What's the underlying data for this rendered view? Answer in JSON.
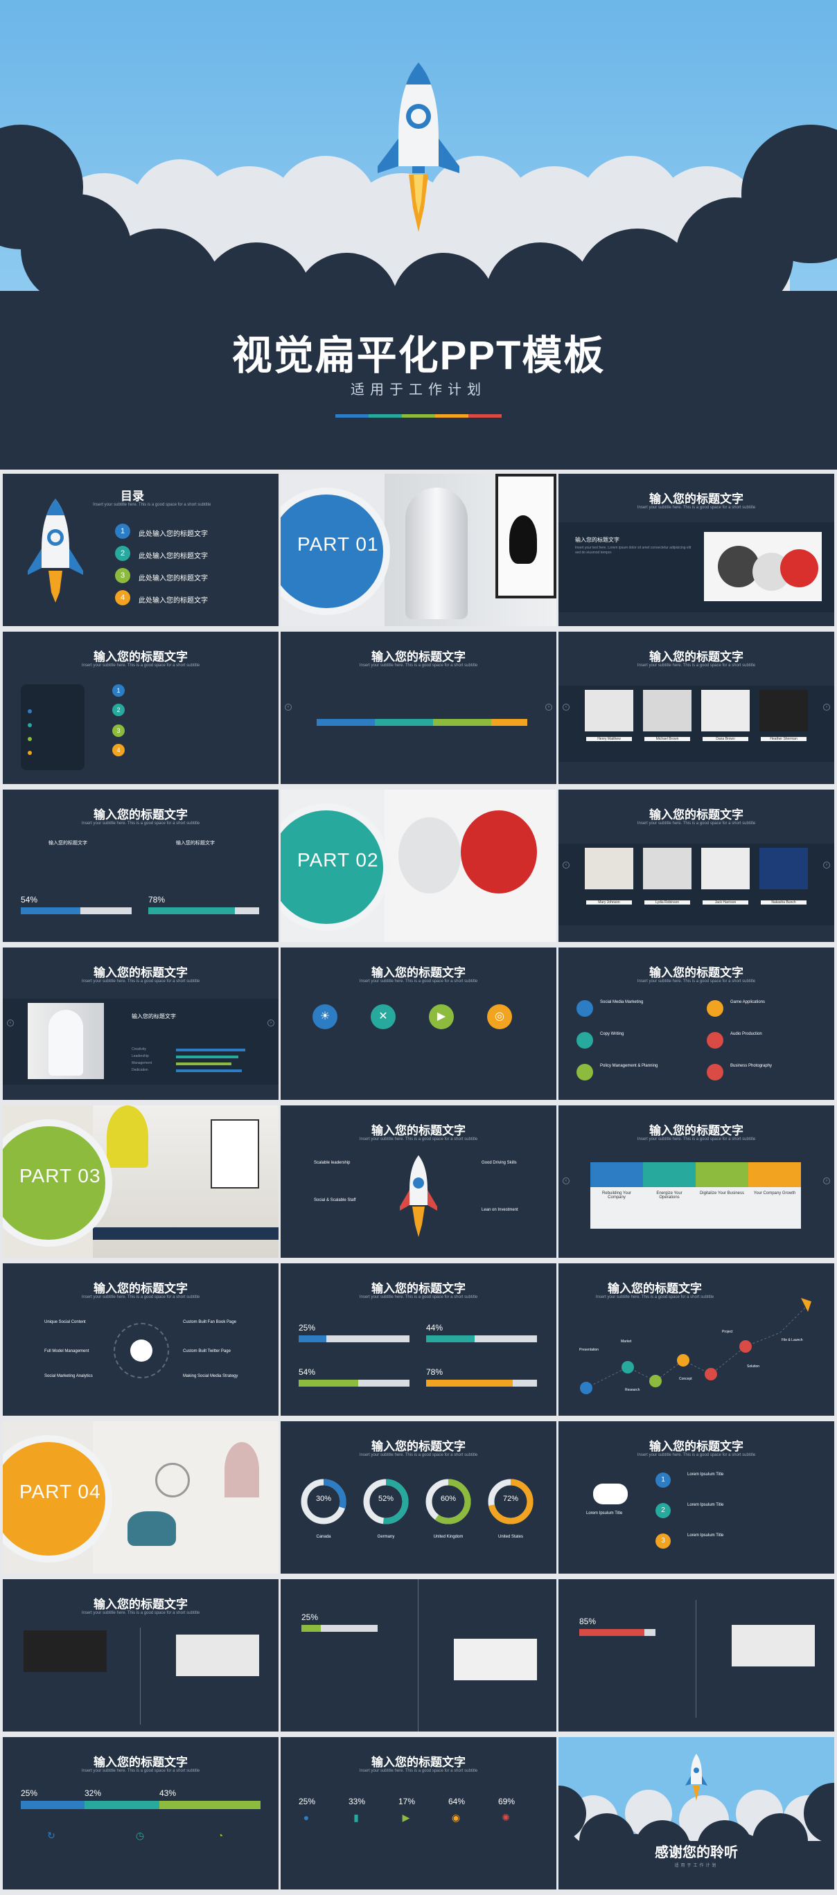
{
  "hero": {
    "title": "视觉扁平化PPT模板",
    "subtitle": "适用于工作计划",
    "colorbar": [
      "#2d7dc4",
      "#28a99e",
      "#8dbb3e",
      "#f2a320",
      "#d94b44"
    ]
  },
  "generic_title": "输入您的标题文字",
  "generic_sub": "Insert your subtitle here. This is a good space for a short subtitle",
  "toc": {
    "title": "目录",
    "items": [
      "此处输入您的标题文字",
      "此处输入您的标题文字",
      "此处输入您的标题文字",
      "此处输入您的标题文字"
    ],
    "numbers": [
      "1",
      "2",
      "3",
      "4"
    ],
    "colors": [
      "#2d7dc4",
      "#28a99e",
      "#8dbb3e",
      "#f2a320"
    ]
  },
  "parts": [
    {
      "label": "PART 01",
      "color": "#2d7dc4"
    },
    {
      "label": "PART 02",
      "color": "#28a99e"
    },
    {
      "label": "PART 03",
      "color": "#8dbb3e"
    },
    {
      "label": "PART 04",
      "color": "#f2a320"
    }
  ],
  "progress_a": [
    {
      "pct": "54%"
    },
    {
      "pct": "78%"
    }
  ],
  "progress_b": [
    {
      "pct": "25%",
      "value": 25,
      "color": "#2d7dc4"
    },
    {
      "pct": "44%",
      "value": 44,
      "color": "#28a99e"
    },
    {
      "pct": "54%",
      "value": 54,
      "color": "#8dbb3e"
    },
    {
      "pct": "78%",
      "value": 78,
      "color": "#f2a320"
    }
  ],
  "donuts": [
    {
      "pct": "30%",
      "value": 30,
      "label": "Canada",
      "color": "#2d7dc4"
    },
    {
      "pct": "52%",
      "value": 52,
      "label": "Germany",
      "color": "#28a99e"
    },
    {
      "pct": "60%",
      "value": 60,
      "label": "United Kingdom",
      "color": "#8dbb3e"
    },
    {
      "pct": "72%",
      "value": 72,
      "label": "United States",
      "color": "#f2a320"
    }
  ],
  "services": {
    "left": [
      "Social Media Marketing",
      "Copy Writing",
      "Policy Management & Planning"
    ],
    "right": [
      "Game Applications",
      "Audio Production",
      "Business Photography"
    ]
  },
  "rocket_labels": [
    "Scalable leadership",
    "Good Driving Skills",
    "Social & Scalable Staff",
    "Lean on Investment"
  ],
  "colored_boxes": [
    "Rebuilding Your Company",
    "Energize Your Operations",
    "Digitalize Your Business",
    "Your Company Growth"
  ],
  "cycle_labels": [
    "Unique Social Content",
    "Custom Built Fan Book Page",
    "Full Model Management",
    "Custom Built Twitter Page",
    "Social Marketing Analytics",
    "Making Social Media Strategy"
  ],
  "path_labels": [
    "Presentation",
    "Market",
    "Research",
    "Concept",
    "Project",
    "Solution",
    "File & Launch"
  ],
  "gamepad_items": [
    "Lorem Ipsulum Title",
    "Lorem Ipsulum Title",
    "Lorem Ipsulum Title"
  ],
  "gamepad_left": "Lorem Ipsulum Title",
  "timeline_pct_a": "25%",
  "timeline_pct_b": "85%",
  "triple_pct": [
    "25%",
    "32%",
    "43%"
  ],
  "five_pct": [
    "25%",
    "33%",
    "17%",
    "64%",
    "69%"
  ],
  "people": [
    "Henry Matthew",
    "Michael Brown",
    "Dana Brown",
    "Heather Sherman"
  ],
  "people2": [
    "Mary Johnson",
    "Lydia Robinson",
    "Jack Harrison",
    "Nakasha Bunch"
  ],
  "skills": [
    "Creativity",
    "Leadership",
    "Management",
    "Dedication"
  ],
  "thanks": "感谢您的聆听",
  "thanks_sub": "适用于工作计划",
  "pnum": "1"
}
